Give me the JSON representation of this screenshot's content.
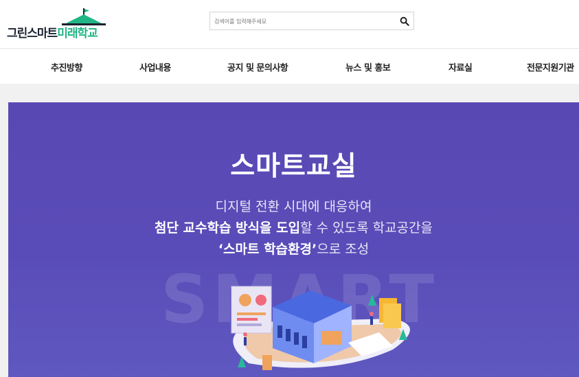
{
  "logo": {
    "part1": "그린스마트",
    "part2": "미래학교"
  },
  "search": {
    "placeholder": "검색어를 입력해주세요"
  },
  "nav": [
    {
      "label": "추진방향"
    },
    {
      "label": "사업내용"
    },
    {
      "label": "공지 및 문의사항"
    },
    {
      "label": "뉴스 및 홍보"
    },
    {
      "label": "자료실"
    },
    {
      "label": "전문지원기관"
    }
  ],
  "hero": {
    "title": "스마트교실",
    "line1": "디지털 전환 시대에 대응하여",
    "line2_bold1": "첨단 교수학습 방식을 도입",
    "line2_rest": "할 수 있도록 학교공간을",
    "line3_bold": "‘스마트 학습환경’",
    "line3_rest": "으로 조성",
    "bg_word": "SMART"
  },
  "colors": {
    "accent_green": "#20b585",
    "hero_purple": "#5848b4"
  }
}
